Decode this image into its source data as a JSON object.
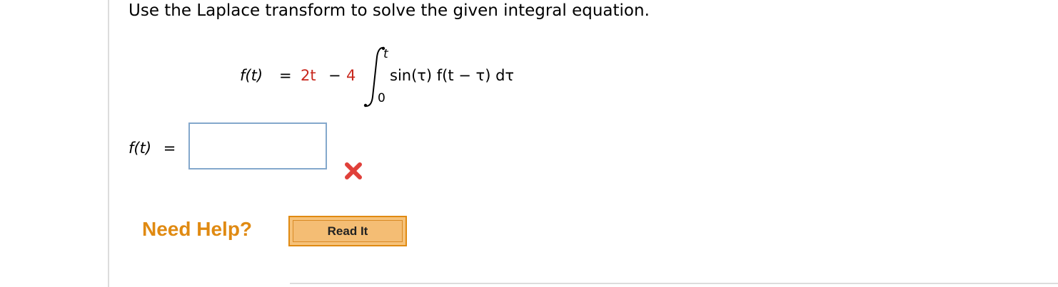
{
  "question": {
    "prompt": "Use the Laplace transform to solve the given integral equation."
  },
  "equation": {
    "lhs": "f(t)",
    "equals": "=",
    "term1": "2t",
    "minus": "−",
    "coefficient": "4",
    "upper_limit": "t",
    "lower_limit": "0",
    "integrand": "sin(τ) f(t − τ) dτ",
    "highlight_color": "#c8271d"
  },
  "answer": {
    "label": "f(t)",
    "equals": "=",
    "value": "",
    "status": "incorrect",
    "status_icon": "x-mark-icon",
    "status_color": "#e0403a"
  },
  "help": {
    "label": "Need Help?",
    "read_button": "Read It"
  }
}
